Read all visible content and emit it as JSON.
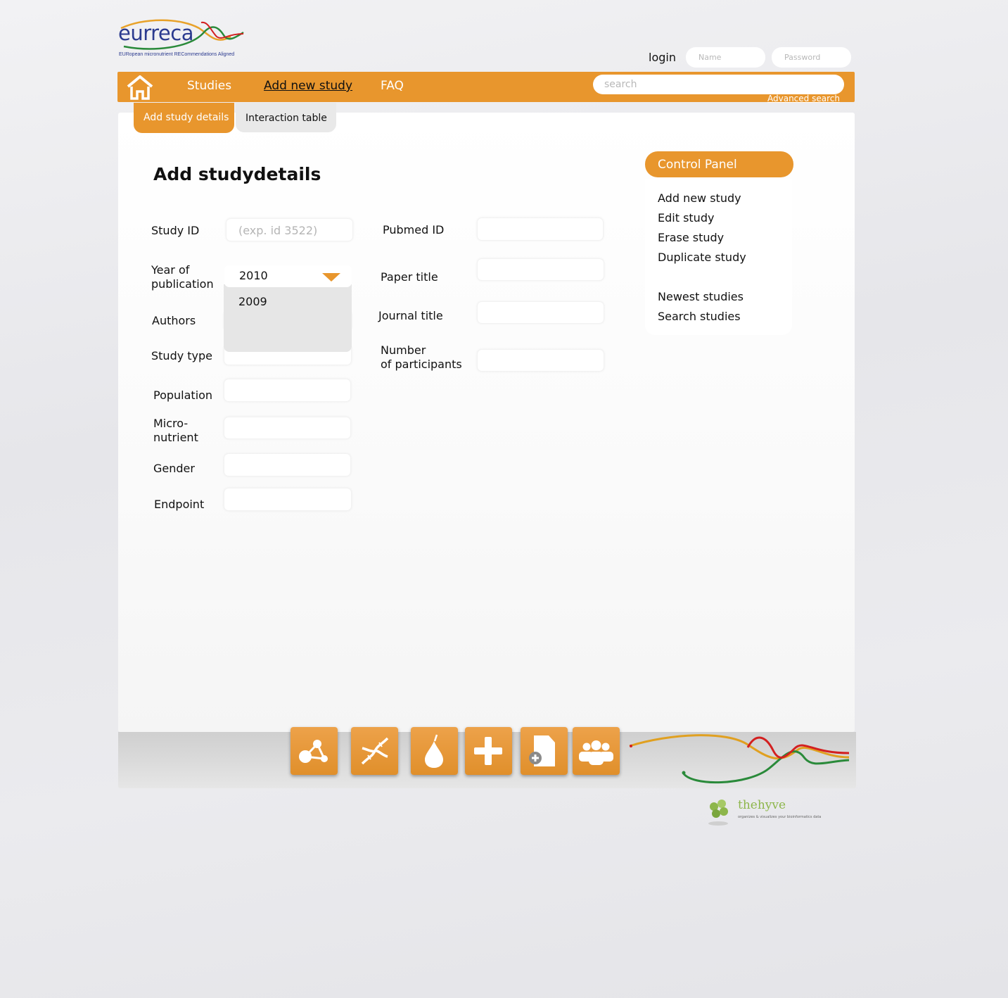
{
  "brand": {
    "logo_word": "eurreca",
    "logo_tagline": "EURopean micronutrient RECommendations Aligned"
  },
  "login": {
    "label": "login",
    "name_placeholder": "Name",
    "password_placeholder": "Password"
  },
  "nav": {
    "home_icon": "home-icon",
    "studies": "Studies",
    "add_new_study": "Add new study",
    "faq": "FAQ",
    "search_placeholder": "search",
    "advanced_search": "Advanced search"
  },
  "tabs": {
    "active": "Add study details",
    "inactive": "Interaction table"
  },
  "form": {
    "title": "Add studydetails",
    "study_id_label": "Study ID",
    "study_id_placeholder": "(exp. id 3522)",
    "pubmed_id_label": "Pubmed ID",
    "year_label_line1": "Year of",
    "year_label_line2": "publication",
    "year_selected": "2010",
    "year_options": [
      "2009"
    ],
    "paper_title_label": "Paper title",
    "authors_label": "Authors",
    "journal_title_label": "Journal title",
    "study_type_label": "Study type",
    "participants_label_line1": "Number",
    "participants_label_line2": "of participants",
    "population_label": "Population",
    "micronutrient_label_line1": "Micro-",
    "micronutrient_label_line2": "nutrient",
    "gender_label": "Gender",
    "endpoint_label": "Endpoint"
  },
  "control_panel": {
    "header": "Control Panel",
    "items": [
      "Add new study",
      "Edit study",
      "Erase study",
      "Duplicate study"
    ],
    "items2": [
      "Newest studies",
      "Search studies"
    ]
  },
  "footer_buttons": [
    {
      "icon": "molecule-icon"
    },
    {
      "icon": "dna-icon"
    },
    {
      "icon": "pear-icon"
    },
    {
      "icon": "plus-icon"
    },
    {
      "icon": "add-document-icon"
    },
    {
      "icon": "group-icon"
    }
  ],
  "partner": {
    "name": "thehyve",
    "tagline": "organizes & visualizes your bioinformatics data"
  },
  "colors": {
    "accent": "#e8962d",
    "brand_blue": "#2b3a8f"
  }
}
